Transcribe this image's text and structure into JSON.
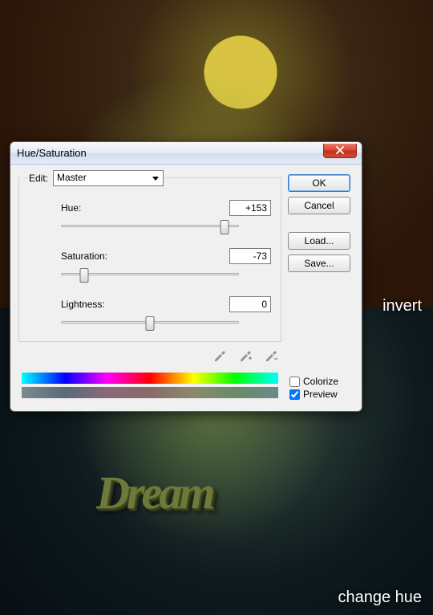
{
  "annotations": {
    "invert": "invert",
    "change_hue": "change hue"
  },
  "artwork_text": "Dream",
  "dialog": {
    "title": "Hue/Saturation",
    "edit_label": "Edit:",
    "edit_value": "Master",
    "hue": {
      "label": "Hue:",
      "value": "+153",
      "min": -180,
      "max": 180,
      "pos_pct": 92
    },
    "saturation": {
      "label": "Saturation:",
      "value": "-73",
      "min": -100,
      "max": 100,
      "pos_pct": 13
    },
    "lightness": {
      "label": "Lightness:",
      "value": "0",
      "min": -100,
      "max": 100,
      "pos_pct": 50
    },
    "buttons": {
      "ok": "OK",
      "cancel": "Cancel",
      "load": "Load...",
      "save": "Save..."
    },
    "colorize": {
      "label": "Colorize",
      "checked": false
    },
    "preview": {
      "label": "Preview",
      "checked": true
    },
    "eyedroppers": [
      "eyedropper",
      "eyedropper-add",
      "eyedropper-subtract"
    ]
  }
}
